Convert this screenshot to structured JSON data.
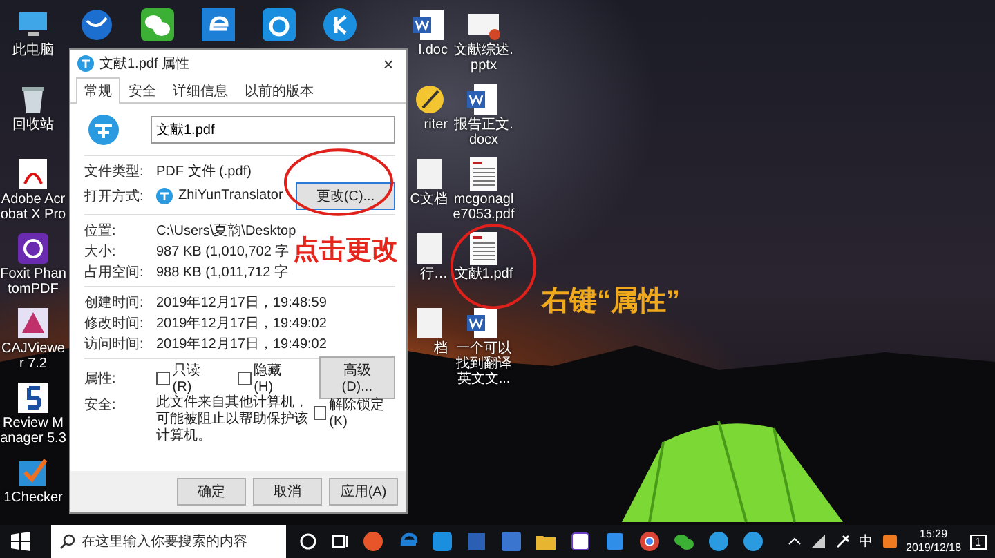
{
  "desktop": {
    "columns": [
      [
        {
          "kind": "pc",
          "label": "此电脑"
        },
        {
          "kind": "bin",
          "label": "回收站"
        },
        {
          "kind": "acrobat",
          "label": "Adobe Acrobat X Pro"
        },
        {
          "kind": "foxit",
          "label": "Foxit PhantomPDF"
        },
        {
          "kind": "caj",
          "label": "CAJViewer 7.2"
        },
        {
          "kind": "revman",
          "label": "Review Manager 5.3"
        },
        {
          "kind": "checker",
          "label": "1Checker"
        }
      ],
      [
        {
          "kind": "ws"
        }
      ],
      [
        {
          "kind": "wechat"
        }
      ],
      [
        {
          "kind": "edge"
        }
      ],
      [
        {
          "kind": "bug"
        }
      ],
      [
        {
          "kind": "k"
        }
      ],
      [
        {
          "kind": "word",
          "label": "l.doc"
        },
        {
          "kind": "pen",
          "label": "riter"
        },
        {
          "kind": "doc",
          "label": "C文档"
        },
        {
          "kind": "doc",
          "label": "行…"
        },
        {
          "kind": "doc",
          "label": "档"
        }
      ],
      [
        {
          "kind": "pptx",
          "label": "文献综述.pptx"
        },
        {
          "kind": "word",
          "label": "报告正文.docx"
        },
        {
          "kind": "pdfdoc",
          "label": "mcgonagle7053.pdf"
        },
        {
          "kind": "pdfdoc",
          "label": "文献1.pdf"
        },
        {
          "kind": "word",
          "label": "一个可以找到翻译英文文..."
        }
      ]
    ]
  },
  "dialog": {
    "title": "文献1.pdf 属性",
    "close": "×",
    "tabs": [
      {
        "label": "常规",
        "selected": true
      },
      {
        "label": "安全",
        "selected": false
      },
      {
        "label": "详细信息",
        "selected": false
      },
      {
        "label": "以前的版本",
        "selected": false
      }
    ],
    "file_name": "文献1.pdf",
    "sections": [
      [
        {
          "label": "文件类型:",
          "value": "PDF 文件 (.pdf)"
        },
        {
          "label": "打开方式:",
          "value": "ZhiYunTranslator",
          "button": "更改(C)..."
        }
      ],
      [
        {
          "label": "位置:",
          "value": "C:\\Users\\夏韵\\Desktop"
        },
        {
          "label": "大小:",
          "value": "987 KB (1,010,702 字"
        },
        {
          "label": "占用空间:",
          "value": "988 KB (1,011,712 字"
        }
      ],
      [
        {
          "label": "创建时间:",
          "value": "2019年12月17日，19:48:59"
        },
        {
          "label": "修改时间:",
          "value": "2019年12月17日，19:49:02"
        },
        {
          "label": "访问时间:",
          "value": "2019年12月17日，19:49:02"
        }
      ]
    ],
    "attributes": {
      "label": "属性:",
      "options": [
        {
          "label": "只读(R)",
          "checked": false
        },
        {
          "label": "隐藏(H)",
          "checked": false
        }
      ],
      "button": "高级(D)..."
    },
    "security": {
      "label": "安全:",
      "text": "此文件来自其他计算机，可能被阻止以帮助保护该计算机。",
      "option": {
        "label": "解除锁定(K)",
        "checked": false
      }
    },
    "buttons": [
      "确定",
      "取消",
      "应用(A)"
    ]
  },
  "annotations": [
    {
      "kind": "click",
      "text": "点击更改"
    },
    {
      "kind": "right",
      "text": "右键“属性”"
    }
  ],
  "taskbar": {
    "search": {
      "placeholder": "在这里输入你要搜索的内容"
    },
    "apps": [
      {
        "kind": "office",
        "color": "#e8552a"
      },
      {
        "kind": "edge",
        "color": "#1e7fd6"
      },
      {
        "kind": "k",
        "color": "#1a8fe0"
      },
      {
        "kind": "word",
        "color": "#2b5fb3"
      },
      {
        "kind": "ws",
        "color": "#3a76d0"
      },
      {
        "kind": "folder",
        "color": "#e8b531"
      },
      {
        "kind": "en",
        "color": "#6b3fc4"
      },
      {
        "kind": "note",
        "color": "#2f8ee8"
      },
      {
        "kind": "chrome",
        "color": "#db4437"
      },
      {
        "kind": "wechat",
        "color": "#3cb034"
      },
      {
        "kind": "zhi",
        "color": "#2a9be0"
      },
      {
        "kind": "zhi",
        "color": "#2a9be0"
      }
    ],
    "ime": "中",
    "time": "15:29",
    "date": "2019/12/18",
    "notifications": "1"
  }
}
